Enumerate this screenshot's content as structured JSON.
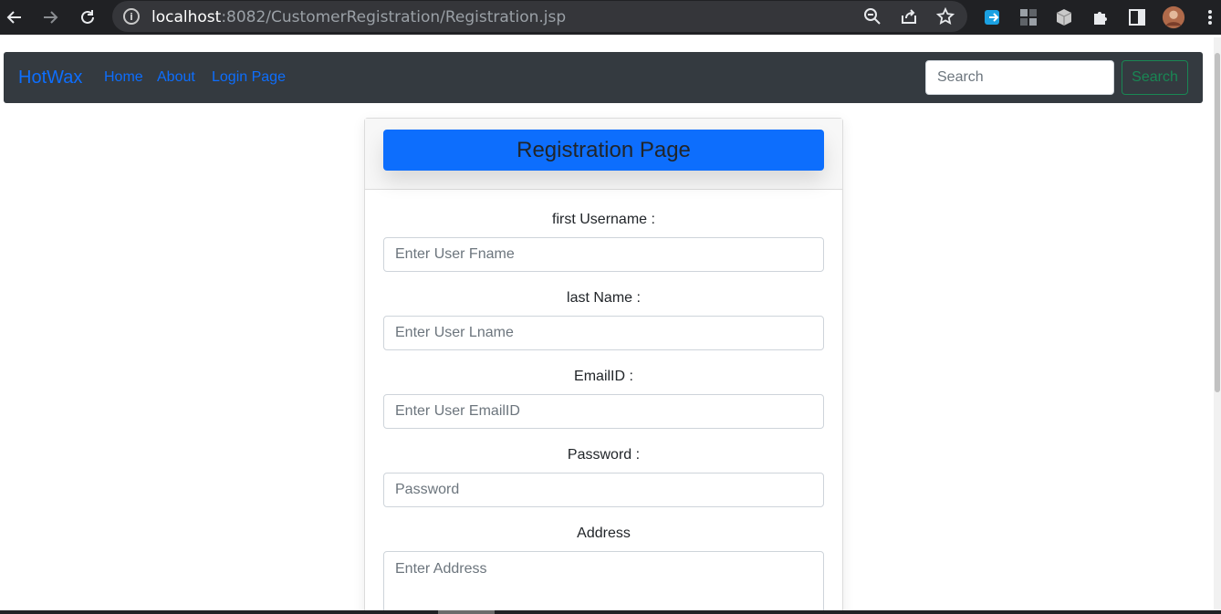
{
  "browser": {
    "url_host": "localhost",
    "url_rest": ":8082/CustomerRegistration/Registration.jsp",
    "icons": [
      "back-icon",
      "forward-icon",
      "reload-icon",
      "info-icon",
      "zoom-icon",
      "share-icon",
      "bookmark-star-icon",
      "extension-icon",
      "puzzle-icon",
      "side-panel-icon",
      "profile-avatar",
      "menu-icon"
    ]
  },
  "navbar": {
    "brand": "HotWax",
    "links": [
      "Home",
      "About",
      "Login Page"
    ],
    "search_placeholder": "Search",
    "search_button": "Search"
  },
  "form": {
    "title": "Registration Page",
    "fields": [
      {
        "label": "first Username :",
        "placeholder": "Enter User Fname"
      },
      {
        "label": "last Name :",
        "placeholder": "Enter User Lname"
      },
      {
        "label": "EmailID :",
        "placeholder": "Enter User EmailID"
      },
      {
        "label": "Password :",
        "placeholder": "Password"
      },
      {
        "label": "Address",
        "placeholder": "Enter Address"
      }
    ]
  },
  "colors": {
    "primary": "#0d6efd",
    "success": "#198754",
    "navbar_bg": "#343a40",
    "chrome_bg": "#202124"
  }
}
